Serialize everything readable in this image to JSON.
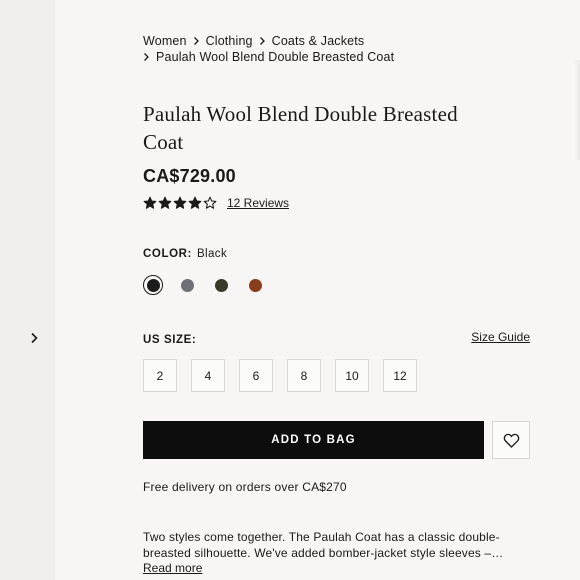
{
  "breadcrumb": {
    "items": [
      "Women",
      "Clothing",
      "Coats & Jackets",
      "Paulah Wool Blend Double Breasted Coat"
    ]
  },
  "product": {
    "title": "Paulah Wool Blend Double Breasted Coat",
    "price": "CA$729.00",
    "rating": {
      "stars_filled": 4,
      "stars_total": 5,
      "reviews_label": "12 Reviews"
    }
  },
  "color": {
    "label": "COLOR:",
    "selected": "Black",
    "swatches": [
      {
        "name": "Black",
        "hex": "#1c1c1c",
        "selected": true
      },
      {
        "name": "Grey",
        "hex": "#6d7077",
        "selected": false
      },
      {
        "name": "Dark Olive",
        "hex": "#3a3a28",
        "selected": false
      },
      {
        "name": "Brown",
        "hex": "#8a3e1e",
        "selected": false
      }
    ]
  },
  "size": {
    "label": "US SIZE:",
    "guide_label": "Size Guide",
    "options": [
      "2",
      "4",
      "6",
      "8",
      "10",
      "12"
    ]
  },
  "actions": {
    "add_to_bag_label": "ADD TO BAG"
  },
  "delivery_text": "Free delivery on orders over CA$270",
  "description": {
    "text": "Two styles come together. The Paulah Coat has a classic double-breasted silhouette. We've added bomber-jacket style sleeves –…",
    "read_more_label": "Read more"
  },
  "icons": {
    "carousel_next": "chevron-right-icon",
    "breadcrumb_separator": "chevron-right-icon",
    "star_filled": "star-filled-icon",
    "star_empty": "star-outline-icon",
    "wishlist": "heart-outline-icon"
  }
}
